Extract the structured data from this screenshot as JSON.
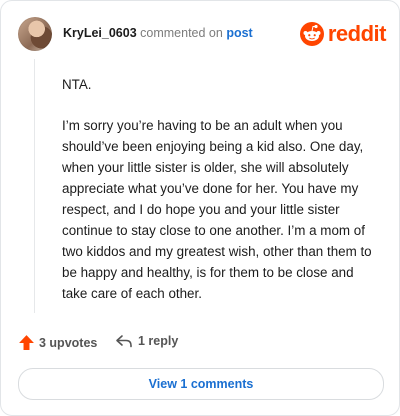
{
  "comment": {
    "username": "KryLei_0603",
    "action_text": "commented on",
    "post_link": "post",
    "paragraphs": [
      "NTA.",
      "I’m sorry you’re having to be an adult when you should’ve been enjoying being a kid also. One day, when your little sister is older, she will absolutely appreciate what you’ve done for her. You have my respect, and I do hope you and your little sister continue to stay close to one another. I’m a mom of two kiddos and my greatest wish, other than them to be happy and healthy, is for them to be close and take care of each other."
    ],
    "upvotes_label": "3 upvotes",
    "replies_label": "1 reply",
    "view_comments_label": "View 1 comments"
  },
  "brand": {
    "wordmark": "reddit",
    "color": "#ff4500"
  },
  "icons": {
    "upvote": "upvote-arrow-icon",
    "reply": "reply-arrow-icon",
    "logo": "reddit-alien-logo"
  },
  "colors": {
    "link": "#1a6fd1",
    "upvote": "#ff4500"
  }
}
